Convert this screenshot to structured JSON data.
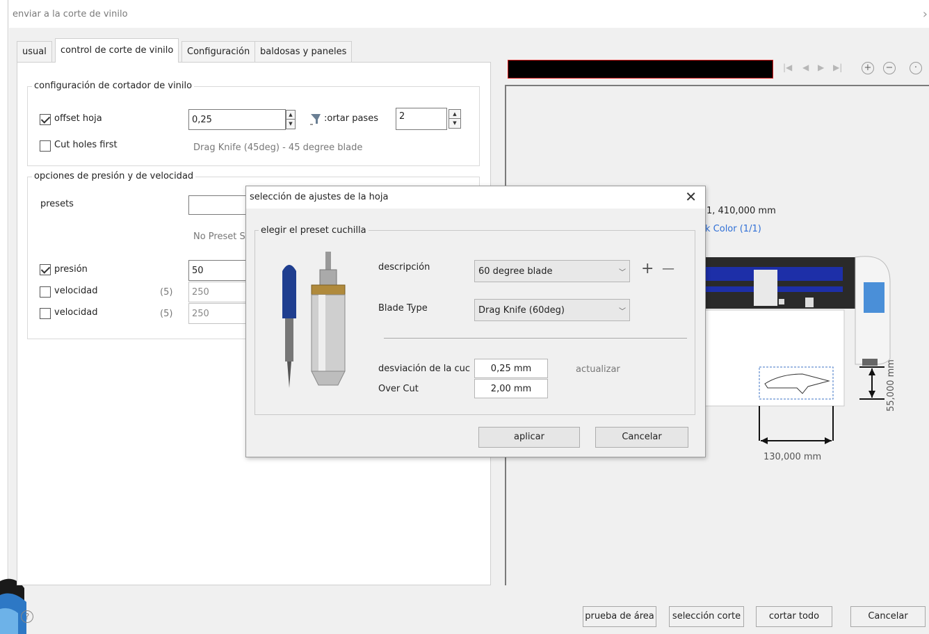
{
  "window": {
    "title": "enviar a la corte de vinilo",
    "close_glyph": "›"
  },
  "tabs": [
    {
      "label": "usual"
    },
    {
      "label": "control de corte de vinilo"
    },
    {
      "label": "Configuración"
    },
    {
      "label": "baldosas y paneles"
    }
  ],
  "cutter_group": {
    "label": "configuración de cortador de vinilo",
    "offset_label": "offset hoja",
    "offset_checked": true,
    "offset_value": "0,25",
    "cut_passes_label": ":ortar pases",
    "cut_passes_value": "2",
    "cut_holes_label": "Cut holes first",
    "cut_holes_checked": false,
    "blade_info": "Drag Knife (45deg) - 45 degree blade"
  },
  "pressure_group": {
    "label": "opciones de presión y de velocidad",
    "presets_label": "presets",
    "presets_value": "",
    "no_preset_text": "No Preset S",
    "pressure_label": "presión",
    "pressure_checked": true,
    "pressure_value": "50",
    "speed1_label": "velocidad",
    "speed1_checked": false,
    "speed1_hint": "(5)",
    "speed1_value": "250",
    "speed2_label": "velocidad",
    "speed2_checked": false,
    "speed2_hint": "(5)",
    "speed2_value": "250"
  },
  "preview": {
    "nav_icons": [
      "first-icon",
      "prev-icon",
      "next-icon",
      "last-icon"
    ],
    "zoom_in": "+",
    "zoom_out": "−",
    "zoom_fit": "·",
    "position_text": "1,  410,000 mm",
    "color_link": "k Color (1/1)",
    "width_dim": "130,000 mm",
    "height_dim": "55,000 mm"
  },
  "buttons": {
    "area_test": "prueba de área",
    "cut_selection": "selección corte",
    "cut_all": "cortar todo",
    "cancel": "Cancelar",
    "help": "?"
  },
  "dialog": {
    "title": "selección de ajustes de la hoja",
    "close": "✕",
    "group_label": "elegir el preset cuchilla",
    "description_label": "descripción",
    "description_value": "60 degree blade",
    "blade_type_label": "Blade Type",
    "blade_type_value": "Drag Knife (60deg)",
    "add": "+",
    "remove": "—",
    "offset_label": "desviación de la cuc",
    "offset_value": "0,25 mm",
    "update_label": "actualizar",
    "overcut_label": "Over Cut",
    "overcut_value": "2,00 mm",
    "apply": "aplicar",
    "cancel": "Cancelar"
  },
  "colors": {
    "accent_link": "#2f6fd6",
    "preview_border": "#d22222",
    "panel_bg": "#f0f0f0"
  }
}
